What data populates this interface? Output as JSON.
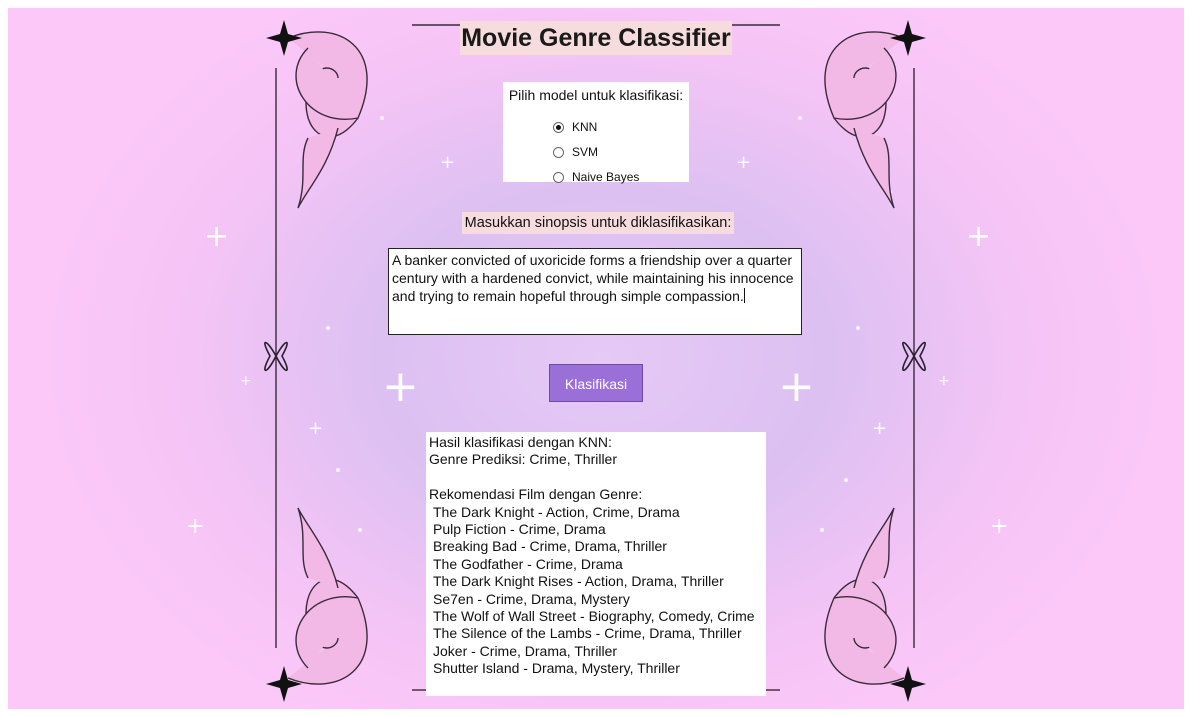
{
  "app": {
    "title": "Movie Genre Classifier"
  },
  "model_select": {
    "label": "Pilih model untuk klasifikasi:",
    "options": [
      "KNN",
      "SVM",
      "Naive Bayes"
    ],
    "selected": "KNN"
  },
  "synopsis": {
    "label": "Masukkan sinopsis untuk diklasifikasikan:",
    "value": "A banker convicted of uxoricide forms a friendship over a quarter century with a hardened convict, while maintaining his innocence and trying to remain hopeful through simple compassion."
  },
  "classify_button": {
    "label": "Klasifikasi"
  },
  "result": {
    "header": "Hasil klasifikasi dengan KNN:",
    "genre_line": "Genre Prediksi: Crime, Thriller",
    "rec_header": "Rekomendasi Film dengan Genre:",
    "recommendations": [
      "The Dark Knight - Action, Crime, Drama",
      "Pulp Fiction - Crime, Drama",
      "Breaking Bad - Crime, Drama, Thriller",
      "The Godfather - Crime, Drama",
      "The Dark Knight Rises - Action, Drama, Thriller",
      "Se7en - Crime, Drama, Mystery",
      "The Wolf of Wall Street - Biography, Comedy, Crime",
      "The Silence of the Lambs - Crime, Drama, Thriller",
      "Joker - Crime, Drama, Thriller",
      "Shutter Island - Drama, Mystery, Thriller"
    ]
  },
  "theme": {
    "accent": "#9a6fd8",
    "background": "#f5c4f6",
    "label_bg": "#f6dcdf"
  }
}
